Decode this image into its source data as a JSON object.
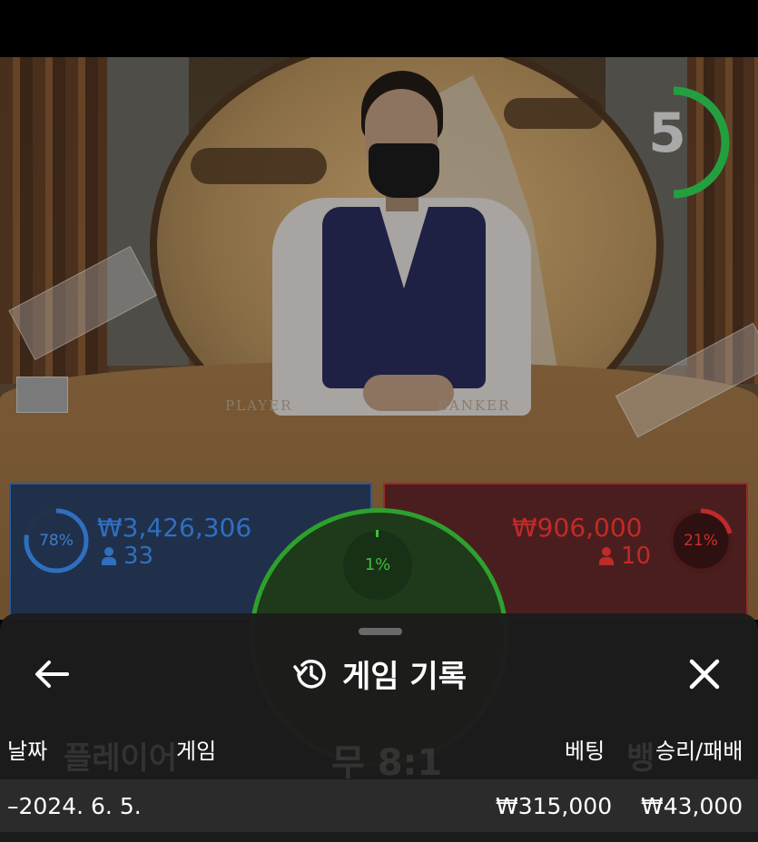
{
  "video": {
    "table_left_label": "PLAYER",
    "table_right_label": "BANKER",
    "countdown": "5",
    "countdown_fraction": 0.5
  },
  "bets": {
    "player": {
      "percent": "78%",
      "percent_value": 0.78,
      "amount": "₩3,426,306",
      "count": "33",
      "color": "#2f6fc0"
    },
    "banker": {
      "percent": "21%",
      "percent_value": 0.21,
      "amount": "₩906,000",
      "count": "10",
      "color": "#c02a2a"
    },
    "tie": {
      "percent": "1%",
      "percent_value": 0.01,
      "color": "#2ea02e"
    }
  },
  "sheet": {
    "title": "게임 기록",
    "back_icon": "arrow-left-icon",
    "history_icon": "history-icon",
    "close_icon": "close-icon",
    "columns": {
      "date": "날짜",
      "game": "게임",
      "bet": "베팅",
      "result": "승리/패배"
    },
    "rows": [
      {
        "date": "–2024. 6. 5.",
        "game": "",
        "bet": "₩315,000",
        "result": "₩43,000"
      }
    ]
  }
}
